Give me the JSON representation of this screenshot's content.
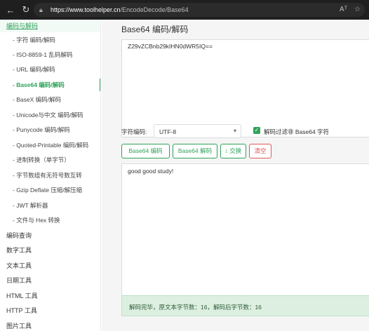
{
  "browser": {
    "url_host": "https://www.toolhelper.cn",
    "url_path": "/EncodeDecode/Base64",
    "reader_icon_text": "Aᵀ",
    "star_icon": "☆"
  },
  "sidebar": {
    "category_top": "编码与解码",
    "sub_items": [
      "- 字符  编码/解码",
      "- ISO-8859-1 乱码解码",
      "- URL  编码/解码",
      "- Base64  编码/解码",
      "- BaseX  编码/解码",
      "- Unicode与中文  编码/解码",
      "- Punycode  编码/解码",
      "- Quoted-Printable  编码/解码",
      "- 进制转换（单字节）",
      "- 字节数组有无符号数互转",
      "- Gzip Deflate 压缩/解压缩",
      "- JWT 解析器",
      "- 文件与 Hex 转换"
    ],
    "categories": [
      "编码查询",
      "数字工具",
      "文本工具",
      "日期工具",
      "HTML 工具",
      "HTTP 工具",
      "图片工具"
    ]
  },
  "main": {
    "title": "Base64 编码/解码",
    "encoded_text": "Z29vZCBnb29kIHN0dWR5IQ==",
    "encoding_label": "字符编码:",
    "encoding_value": "UTF-8",
    "filter_label": "解码过滤非 Base64 字符",
    "buttons": {
      "encode": "Base64 编码",
      "decode": "Base64 解码",
      "swap": "↕ 交换",
      "clear": "清空"
    },
    "decoded_text": "good good study!",
    "status": "解码完毕，原文本字节数：16，解码后字节数：16"
  },
  "colors": {
    "accent": "#2fa35b",
    "danger": "#e05a5a",
    "status_bg": "#dcefe0"
  }
}
